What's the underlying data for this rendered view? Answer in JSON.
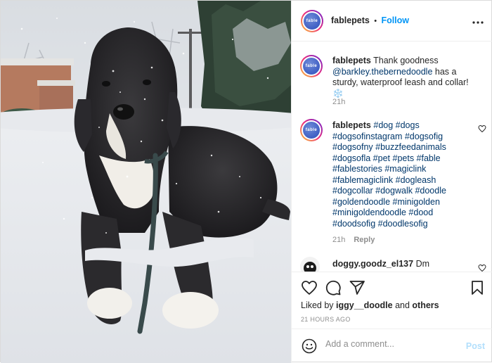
{
  "account": {
    "username": "fablepets",
    "avatar_text": "fable",
    "follow_label": "Follow",
    "dot": "•"
  },
  "caption": {
    "username": "fablepets",
    "text_before": "Thank goodness ",
    "mention": "@barkley.thebernedoodle",
    "text_after": " has a sturdy, waterproof leash and collar! ❄️",
    "time": "21h"
  },
  "hashtag_comment": {
    "username": "fablepets",
    "tags": "#dog #dogs #dogsofinstagram #dogsofig #dogsofny #buzzfeedanimals #dogsofla #pet #pets #fable #fablestories #magiclink #fablemagiclink #dogleash #dogcollar #dogwalk #doodle #goldendoodle #minigolden #minigoldendoodle #dood #doodsofig #doodlesofig",
    "time": "21h",
    "reply_label": "Reply"
  },
  "third_comment": {
    "username": "doggy.goodz_el137",
    "text": "Dm"
  },
  "likes": {
    "prefix": "Liked by ",
    "user": "iggy__doodle",
    "mid": " and ",
    "others": "others"
  },
  "timestamp": "21 HOURS AGO",
  "composer": {
    "placeholder": "Add a comment...",
    "post_label": "Post"
  },
  "colors": {
    "accent": "#0095f6",
    "tag": "#00376b",
    "muted": "#8e8e8e",
    "post_disabled": "#b2dffc"
  },
  "icons": [
    "more-icon",
    "heart-icon",
    "comment-icon",
    "share-icon",
    "bookmark-icon",
    "emoji-icon"
  ]
}
